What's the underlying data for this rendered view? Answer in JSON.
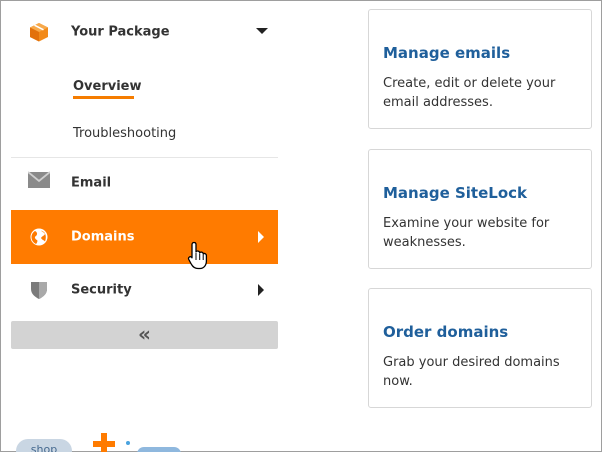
{
  "sidebar": {
    "package": {
      "label": "Your Package",
      "icon": "box-icon"
    },
    "subitems": [
      {
        "label": "Overview",
        "active": true
      },
      {
        "label": "Troubleshooting",
        "active": false
      }
    ],
    "email": {
      "label": "Email",
      "icon": "envelope-icon"
    },
    "domains": {
      "label": "Domains",
      "icon": "globe-icon",
      "active": true
    },
    "security": {
      "label": "Security",
      "icon": "shield-icon"
    },
    "collapse": {
      "label": "«"
    }
  },
  "cards": [
    {
      "title": "Manage emails",
      "description": "Create, edit or delete your email addresses."
    },
    {
      "title": "Manage SiteLock",
      "description": "Examine your website for weaknesses."
    },
    {
      "title": "Order domains",
      "description": "Grab your desired domains now."
    }
  ],
  "footer": {
    "chip_label": "shop"
  },
  "colors": {
    "accent": "#ff7b00",
    "link": "#1f5f9b",
    "collapse_bar": "#d3d3d3"
  }
}
